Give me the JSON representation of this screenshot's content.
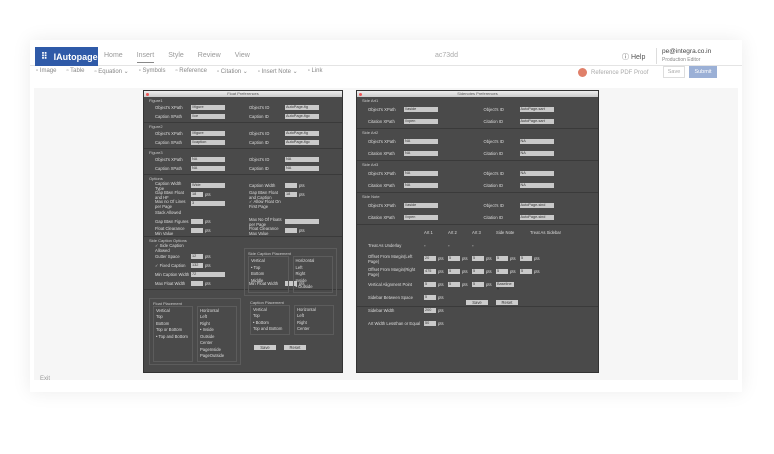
{
  "app": {
    "brand": "IAutopage",
    "tabs": [
      "Home",
      "Insert",
      "Style",
      "Review",
      "View"
    ],
    "active_tab": "Insert",
    "doc_id": "ac73dd",
    "help": "Help",
    "user_email": "pe@integra.co.in",
    "user_role": "Production Editor"
  },
  "toolbar": {
    "items": [
      "Image",
      "Table",
      "Equation ⌄",
      "Symbols",
      "Reference",
      "Citation ⌄",
      "Insert Note ⌄",
      "Link"
    ],
    "reference_pdf": "Reference PDF Proof",
    "save": "Save",
    "submit": "Submit"
  },
  "footer": {
    "exit": "Exit"
  },
  "left_dialog": {
    "title": "Float Preferences",
    "sections": [
      {
        "name": "Figure1",
        "rows": [
          [
            [
              "Object's XPath",
              "//figure"
            ],
            [
              "Object's ID",
              "AutoPage-fig"
            ]
          ],
          [
            [
              "Caption XPath",
              "//ce"
            ],
            [
              "Caption ID",
              "AutoPage-figc"
            ]
          ]
        ]
      },
      {
        "name": "Figure2",
        "rows": [
          [
            [
              "Object's XPath",
              "//figure"
            ],
            [
              "Object's ID",
              "AutoPage-fig"
            ]
          ],
          [
            [
              "Caption XPath",
              "//caption"
            ],
            [
              "Caption ID",
              "AutoPage-figc"
            ]
          ]
        ]
      },
      {
        "name": "Figure3",
        "rows": [
          [
            [
              "Object's XPath",
              "NA"
            ],
            [
              "Object's ID",
              "NA"
            ]
          ],
          [
            [
              "Caption XPath",
              "NA"
            ],
            [
              "Caption ID",
              "NA"
            ]
          ]
        ]
      },
      {
        "name": "Options",
        "rows": [
          [
            [
              "Caption Width Type",
              "Wide"
            ],
            [
              "Caption Width",
              "",
              "pts"
            ]
          ],
          [
            [
              "Gap Btwn Float and HF",
              "18",
              "pts"
            ],
            [
              "Gap Btwn Float and Caption",
              "18",
              "pts"
            ]
          ],
          [
            [
              "Max no Of Lines per Page",
              "3"
            ],
            [
              "✓ Allow Float On First Page"
            ]
          ],
          [
            [
              "Stack Allowed"
            ]
          ],
          [
            [
              "Gap Btwn Figures",
              "",
              "pts"
            ],
            [
              "Max No Of Floats per Page",
              ""
            ]
          ],
          [
            [
              "Float Clearance Min Value",
              "",
              "pts"
            ],
            [
              "Float Clearance Max Value",
              "",
              "pts"
            ]
          ]
        ]
      }
    ],
    "side_caption": {
      "name": "Side Caption Options",
      "rows": [
        [
          [
            "✓ Side Caption Allowed"
          ]
        ],
        [
          [
            "Gutter Space",
            "12",
            "pts"
          ]
        ],
        [
          [
            "✓ Fixed Caption",
            "132",
            "pts"
          ]
        ],
        [
          [
            "Min Caption Width",
            "72"
          ]
        ],
        [
          [
            "Max Float Width",
            "",
            "pts"
          ],
          [
            "Min Float Width",
            "",
            "pts"
          ]
        ]
      ],
      "placement_title": "Side Caption Placement",
      "vertical": [
        "Top",
        "Bottom",
        "Middle"
      ],
      "vertical_sel": "Top",
      "horizontal": [
        "Left",
        "Right",
        "Inside",
        "Outside"
      ],
      "horizontal_sel": "Outside"
    },
    "float_placement": {
      "title": "Float Placement",
      "vertical": [
        "Top",
        "Bottom",
        "Top or Bottom",
        "Top and Bottom"
      ],
      "vertical_sel": "Top and Bottom",
      "horizontal": [
        "Left",
        "Right",
        "Inside",
        "Outside",
        "Center",
        "PageInside",
        "PageOutside"
      ],
      "horizontal_sel": "Inside"
    },
    "caption_placement": {
      "title": "Caption Placement",
      "vertical": [
        "Top",
        "Bottom",
        "Top and Bottom"
      ],
      "vertical_sel": "Bottom",
      "horizontal": [
        "Left",
        "Right",
        "Center"
      ]
    },
    "labels": {
      "vertical": "Vertical",
      "horizontal": "Horizontal"
    },
    "buttons": {
      "save": "Save",
      "reset": "Reset"
    }
  },
  "right_dialog": {
    "title": "Sidenotes Preferences",
    "sections": [
      {
        "name": "Side Art1",
        "rows": [
          [
            [
              "Object's XPath",
              "//aside"
            ],
            [
              "Object's ID",
              "AutoPage-sart"
            ]
          ],
          [
            [
              "Citation XPath",
              "//xpen"
            ],
            [
              "Citation ID",
              "AutoPage-sart"
            ]
          ]
        ]
      },
      {
        "name": "Side Art2",
        "rows": [
          [
            [
              "Object's XPath",
              "NA"
            ],
            [
              "Object's ID",
              "NA"
            ]
          ],
          [
            [
              "Citation XPath",
              "NA"
            ],
            [
              "Citation ID",
              "NA"
            ]
          ]
        ]
      },
      {
        "name": "Side Art3",
        "rows": [
          [
            [
              "Object's XPath",
              "NA"
            ],
            [
              "Object's ID",
              "NA"
            ]
          ],
          [
            [
              "Citation XPath",
              "NA"
            ],
            [
              "Citation ID",
              "NA"
            ]
          ]
        ]
      },
      {
        "name": "Side Note",
        "rows": [
          [
            [
              "Object's XPath",
              "//aside"
            ],
            [
              "Object's ID",
              "AutoPage-sind"
            ]
          ],
          [
            [
              "Citation XPath",
              "//xpen"
            ],
            [
              "Citation ID",
              "AutoPage-sind"
            ]
          ]
        ]
      }
    ],
    "table": {
      "headers": [
        "Art 1",
        "Art 2",
        "Art 3",
        "Side Note",
        "Treat As Sidebar"
      ],
      "rows": [
        {
          "label": "Treat As Underlay",
          "checks": 3
        },
        {
          "label": "Offset From Margin(Left Page)",
          "values": [
            "20",
            "5",
            "5",
            "5",
            "5"
          ],
          "unit": "pts"
        },
        {
          "label": "Offset From Margin(Right Page)",
          "values": [
            "475",
            "5",
            "5",
            "5",
            "5"
          ],
          "unit": "pts"
        },
        {
          "label": "Vertical Alignment Point",
          "values": [
            "5",
            "5",
            "5"
          ],
          "unit": "pts",
          "select": "Baseline ▾"
        },
        {
          "label": "Sidebar Between Space",
          "values": [
            "5"
          ],
          "unit": "pts"
        },
        {
          "label": "Sidebar Width",
          "values": [
            "200"
          ],
          "unit": "pts"
        },
        {
          "label": "Art Width Lessthan or Equal",
          "values": [
            "50"
          ],
          "unit": "pts"
        }
      ]
    },
    "buttons": {
      "save": "Save",
      "reset": "Reset"
    }
  }
}
